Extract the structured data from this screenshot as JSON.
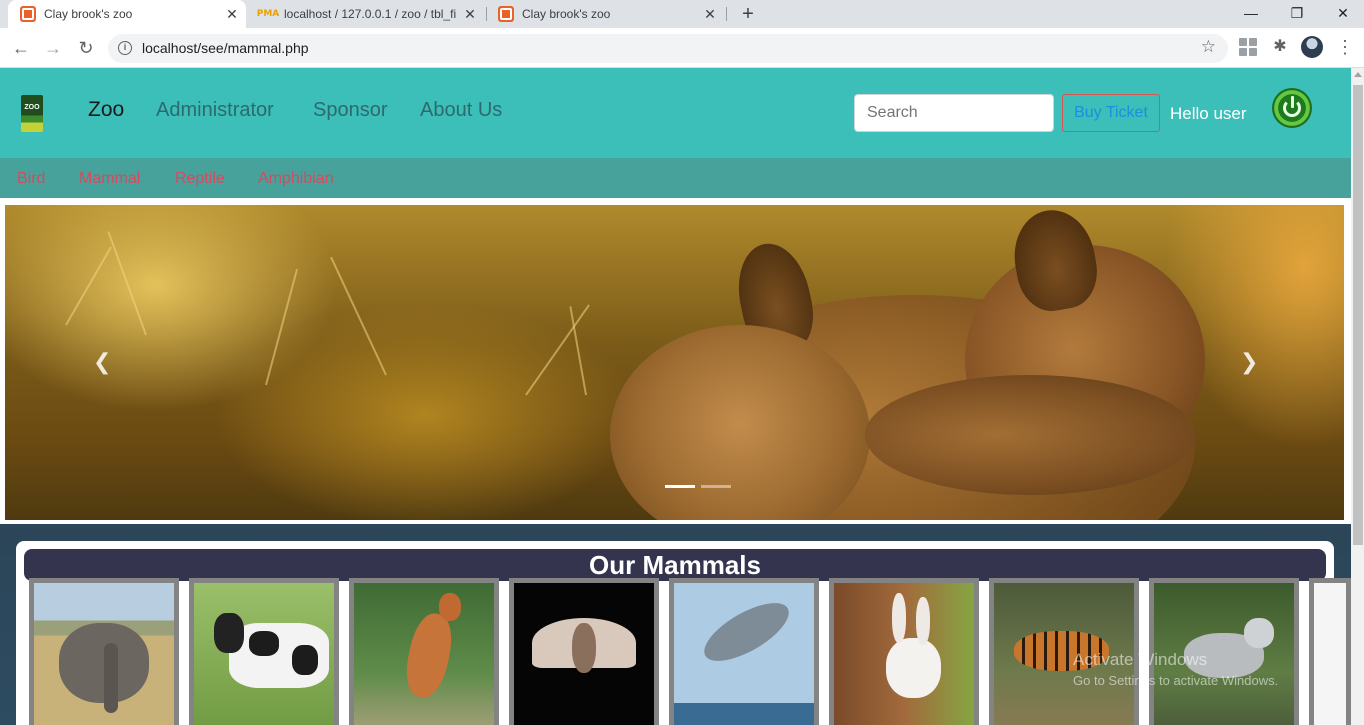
{
  "browser": {
    "tabs": [
      {
        "title": "Clay brook's zoo",
        "favicon": "zoo-icon",
        "active": true
      },
      {
        "title": "localhost / 127.0.0.1 / zoo / tbl_fi",
        "favicon": "phpmyadmin-icon",
        "active": false
      },
      {
        "title": "Clay brook's zoo",
        "favicon": "zoo-icon",
        "active": false
      }
    ],
    "url": "localhost/see/mammal.php"
  },
  "nav": {
    "brand": "Zoo",
    "links": [
      "Administrator",
      "Sponsor",
      "About Us"
    ],
    "search_placeholder": "Search",
    "buy_ticket": "Buy Ticket",
    "greeting": "Hello user"
  },
  "categories": [
    "Bird",
    "Mammal",
    "Reptile",
    "Amphibian"
  ],
  "carousel": {
    "slide_count": 3,
    "active_index": 1
  },
  "mammals": {
    "title": "Our Mammals",
    "items": [
      "elephant",
      "cow",
      "kangaroo",
      "bat",
      "dolphin",
      "rabbit",
      "tiger",
      "wolf"
    ]
  },
  "watermark": {
    "line1": "Activate Windows",
    "line2": "Go to Settings to activate Windows."
  }
}
